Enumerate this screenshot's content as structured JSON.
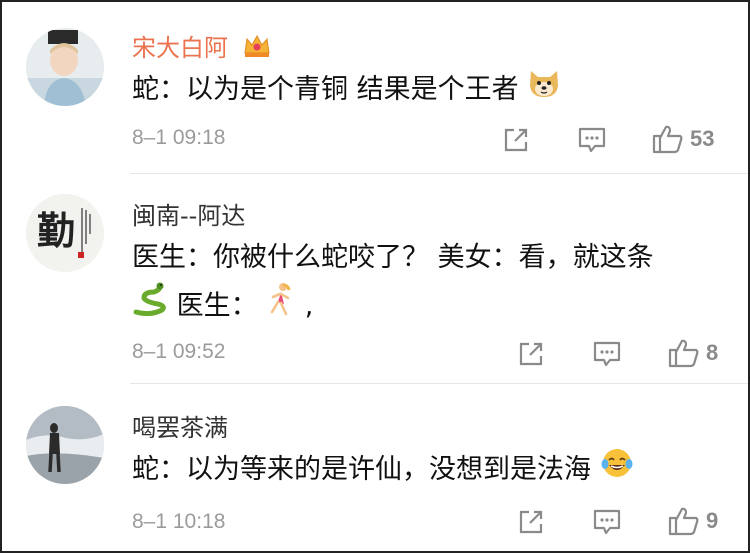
{
  "comments": [
    {
      "username": "宋大白阿",
      "text": "蛇：以为是个青铜 结果是个王者",
      "emoji": "doge-icon",
      "time": "8–1 09:18",
      "likes": "53"
    },
    {
      "username": "闽南--阿达",
      "text_line1": "医生：你被什么蛇咬了？ 美女：看，就这条",
      "text_line2": "医生：",
      "text_line2_end": ",",
      "avatar_text": "勤",
      "time": "8–1 09:52",
      "likes": "8"
    },
    {
      "username": "喝罢茶满",
      "text": "蛇：以为等来的是许仙，没想到是法海",
      "emoji": "laughing-tears-icon",
      "time": "8–1 10:18",
      "likes": "9"
    }
  ],
  "colors": {
    "vip_name": "#eb7350",
    "username": "#333333",
    "meta": "#9b9b9b",
    "icon": "#8a8a8a"
  }
}
